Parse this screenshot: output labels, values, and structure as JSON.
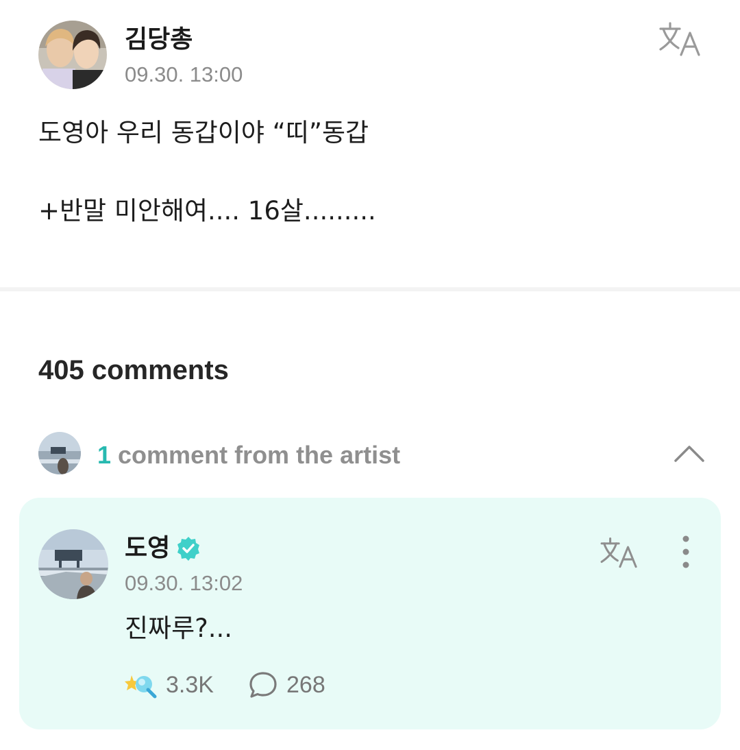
{
  "post": {
    "author": "김당총",
    "timestamp": "09.30. 13:00",
    "lines": [
      "도영아 우리 동갑이야 “띠”동갑",
      "+반말 미안해여.... 16살........."
    ],
    "translate_icon": "translate-icon"
  },
  "comments": {
    "count_label": "405 comments",
    "artist_summary": {
      "count": "1",
      "label": " comment from the artist",
      "toggle_icon": "chevron-up-icon"
    },
    "artist_comment": {
      "author": "도영",
      "verified_icon": "verified-badge-icon",
      "timestamp": "09.30. 13:02",
      "text": "진짜루?...",
      "likes": "3.3K",
      "replies": "268",
      "like_icon": "sparkle-heart-icon",
      "reply_icon": "speech-bubble-icon",
      "more_icon": "more-vertical-icon"
    }
  },
  "colors": {
    "accent": "#27b9b0",
    "card_background": "#e8fbf7",
    "verified": "#3fd0c9",
    "muted_text": "#8b8b8b"
  }
}
